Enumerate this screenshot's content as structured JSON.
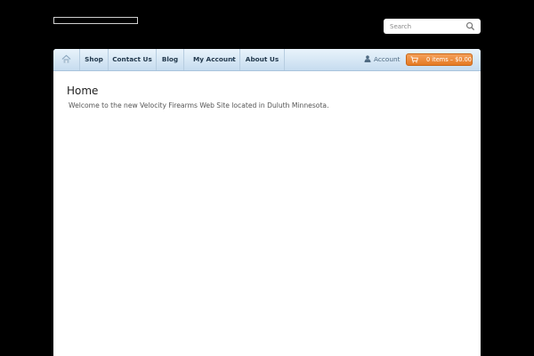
{
  "search": {
    "placeholder": "Search"
  },
  "nav": {
    "items": [
      {
        "label": "Shop"
      },
      {
        "label": "Contact Us"
      },
      {
        "label": "Blog"
      },
      {
        "label": "My Account"
      },
      {
        "label": "About Us"
      }
    ],
    "account_label": "Account",
    "cart_label": "0 items – $0.00"
  },
  "page": {
    "title": "Home",
    "intro": "Welcome to the new Velocity Firearms Web Site located in Duluth Minnesota."
  },
  "colors": {
    "background": "#000000",
    "nav_gradient_top": "#e9f3fb",
    "nav_gradient_bottom": "#c6dcef",
    "cart_orange": "#e57a24"
  },
  "icons": {
    "home": "home-icon",
    "search": "search-icon",
    "user": "user-icon",
    "cart": "cart-icon"
  }
}
